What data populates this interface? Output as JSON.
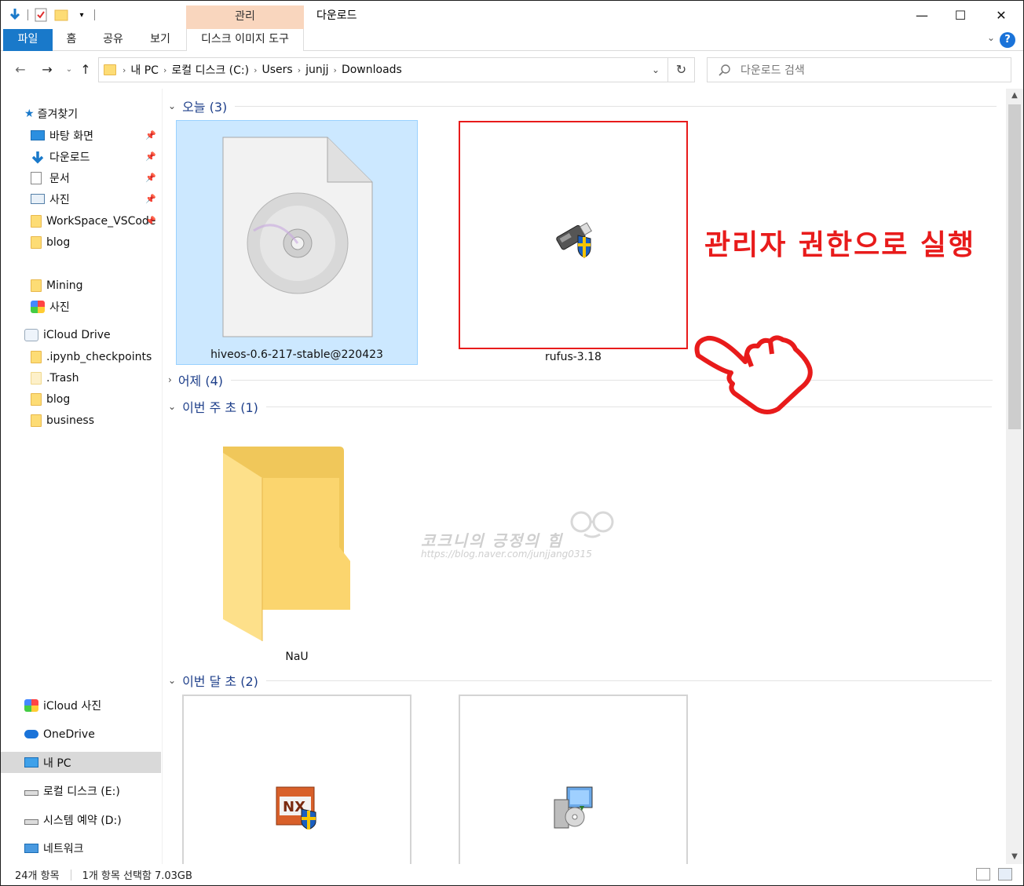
{
  "window": {
    "title": "다운로드",
    "context_tab": "관리",
    "controls": {
      "minimize": "—",
      "maximize": "☐",
      "close": "✕"
    }
  },
  "ribbon": {
    "tabs": [
      "파일",
      "홈",
      "공유",
      "보기"
    ],
    "context_tool": "디스크 이미지 도구",
    "help": "?"
  },
  "address": {
    "crumbs": [
      "내 PC",
      "로컬 디스크 (C:)",
      "Users",
      "junjj",
      "Downloads"
    ],
    "search_placeholder": "다운로드 검색"
  },
  "nav": {
    "quick_access": "즐겨찾기",
    "items": [
      {
        "label": "바탕 화면",
        "pinned": true
      },
      {
        "label": "다운로드",
        "pinned": true
      },
      {
        "label": "문서",
        "pinned": true
      },
      {
        "label": "사진",
        "pinned": true
      },
      {
        "label": "WorkSpace_VSCode",
        "pinned": true
      },
      {
        "label": "blog",
        "pinned": false
      },
      {
        "label": "Mining",
        "pinned": false
      },
      {
        "label": "사진",
        "pinned": false
      },
      {
        "label": "iCloud Drive",
        "pinned": false
      },
      {
        "label": ".ipynb_checkpoints",
        "pinned": false
      },
      {
        "label": ".Trash",
        "pinned": false
      },
      {
        "label": "blog",
        "pinned": false
      },
      {
        "label": "business",
        "pinned": false
      },
      {
        "label": "iCloud 사진",
        "pinned": false
      },
      {
        "label": "OneDrive",
        "pinned": false
      },
      {
        "label": "내 PC",
        "pinned": false
      },
      {
        "label": "로컬 디스크 (E:)",
        "pinned": false
      },
      {
        "label": "시스템 예약 (D:)",
        "pinned": false
      },
      {
        "label": "네트워크",
        "pinned": false
      }
    ]
  },
  "groups": {
    "today": "오늘 (3)",
    "yesterday": "어제 (4)",
    "week_start": "이번 주 초 (1)",
    "month_start": "이번 달 초 (2)"
  },
  "files": {
    "hiveos": "hiveos-0.6-217-stable@220423",
    "rufus": "rufus-3.18",
    "nau": "NaU"
  },
  "annotation": "관리자 권한으로 실행",
  "watermark": {
    "title": "코크니의 긍정의 힘",
    "url": "https://blog.naver.com/junjjang0315"
  },
  "status": {
    "count": "24개 항목",
    "selection": "1개 항목 선택함 7.03GB"
  },
  "colors": {
    "accent": "#1979ca",
    "annotation_red": "#e81b1b",
    "selection": "#cce8ff",
    "context_tab": "#f9d6be"
  }
}
